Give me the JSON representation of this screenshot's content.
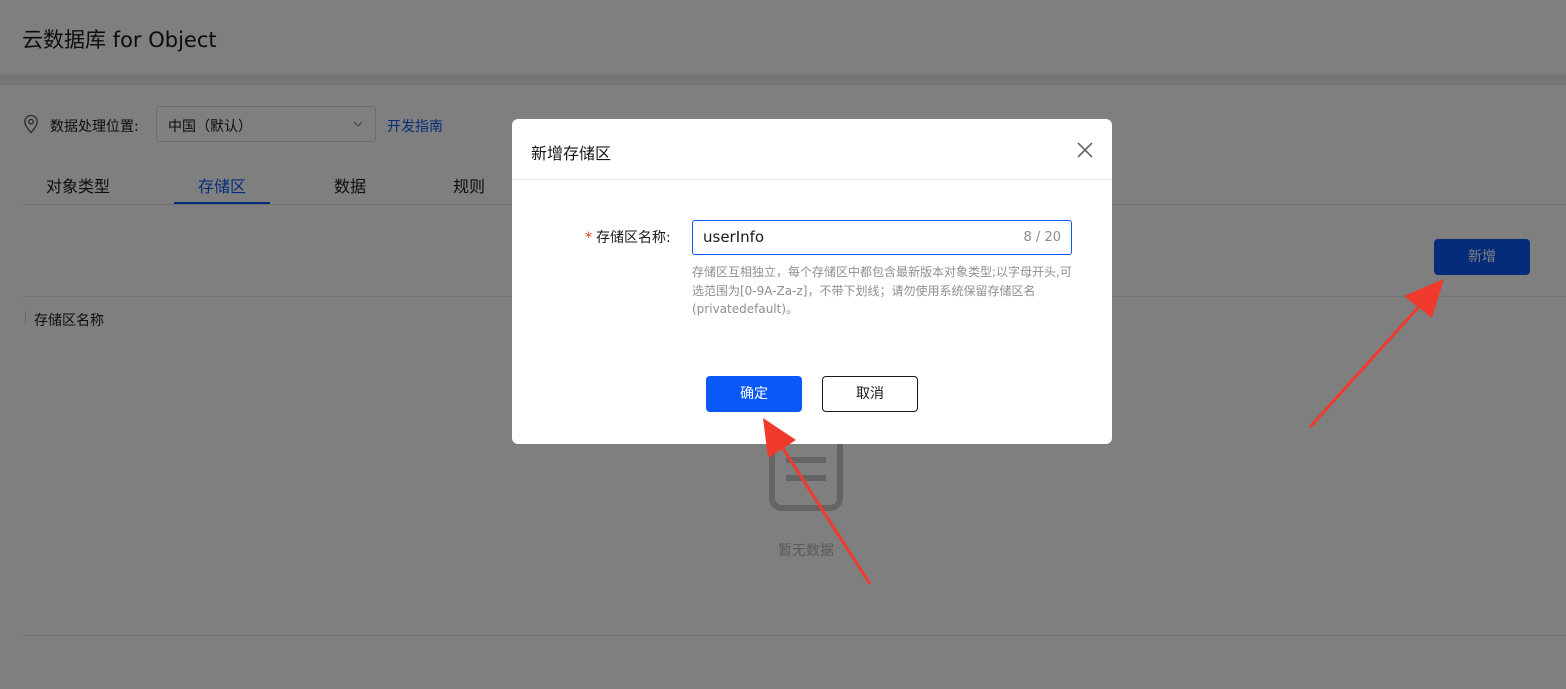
{
  "header": {
    "title": "云数据库 for Object"
  },
  "location": {
    "label": "数据处理位置:",
    "selected": "中国（默认）",
    "dev_guide_link": "开发指南"
  },
  "tabs": [
    {
      "label": "对象类型",
      "active": false
    },
    {
      "label": "存储区",
      "active": true
    },
    {
      "label": "数据",
      "active": false
    },
    {
      "label": "规则",
      "active": false
    }
  ],
  "toolbar": {
    "add_label": "新增"
  },
  "table": {
    "columns": [
      "存储区名称"
    ],
    "empty_text": "暂无数据"
  },
  "dialog": {
    "title": "新增存储区",
    "field_label": "存储区名称:",
    "required_mark": "*",
    "input_value": "userInfo",
    "input_counter": "8 / 20",
    "hint": "存储区互相独立，每个存储区中都包含最新版本对象类型;以字母开头,可选范围为[0-9A-Za-z]，不带下划线；请勿使用系统保留存储区名(privatedefault)。",
    "ok_label": "确定",
    "cancel_label": "取消"
  },
  "colors": {
    "primary": "#0a59f7",
    "annotation_arrow": "#f03a2e",
    "mask": "rgba(0,0,0,0.5)"
  },
  "icons": [
    "location-pin-icon",
    "chevron-down-icon",
    "close-icon",
    "empty-document-icon"
  ]
}
